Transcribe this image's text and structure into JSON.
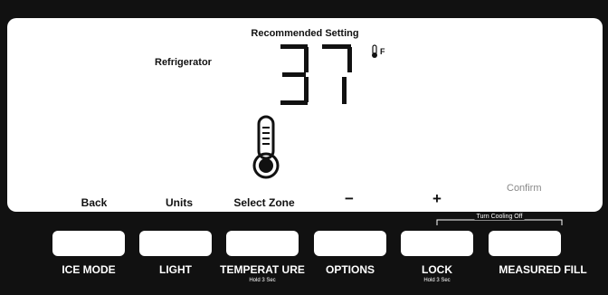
{
  "display": {
    "recommended_label": "Recommended Setting",
    "zone_label": "Refrigerator",
    "temperature_value": "37",
    "temperature_unit": "F",
    "confirm_label": "Confirm",
    "keys": {
      "back": "Back",
      "units": "Units",
      "select_zone": "Select Zone",
      "minus": "−",
      "plus": "+"
    }
  },
  "buttons": [
    {
      "label": "ICE MODE",
      "sub": ""
    },
    {
      "label": "LIGHT",
      "sub": ""
    },
    {
      "label": "TEMPERAT URE",
      "sub": "Hold 3 Sec"
    },
    {
      "label": "OPTIONS",
      "sub": ""
    },
    {
      "label": "LOCK",
      "sub": "Hold 3 Sec"
    },
    {
      "label": "MEASURED FILL",
      "sub": ""
    }
  ],
  "turn_cooling_off_label": "Turn Cooling Off",
  "icons": {
    "thermometer": "thermometer-icon",
    "unit_indicator": "thermometer-small-icon"
  },
  "colors": {
    "panel": "#111111",
    "screen": "#ffffff",
    "text_dark": "#111111",
    "text_muted": "#888888"
  }
}
